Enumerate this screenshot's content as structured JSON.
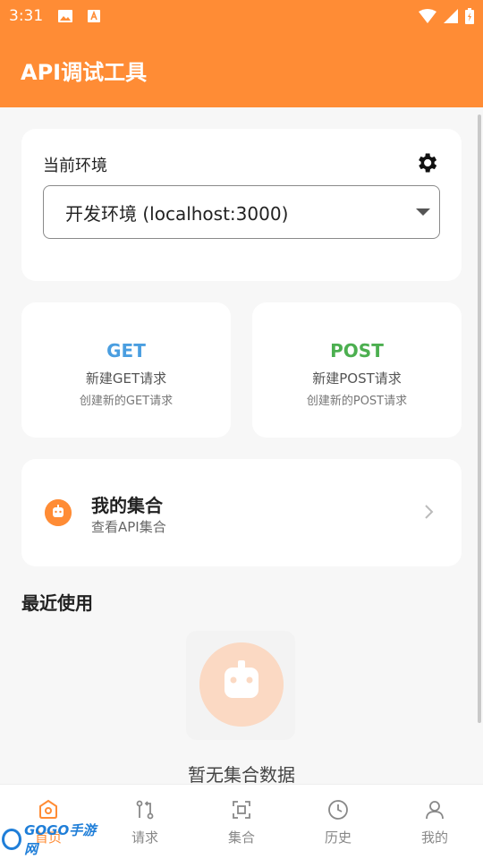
{
  "status_bar": {
    "time": "3:31",
    "icons": [
      "image-icon",
      "a-notification-icon",
      "wifi-icon",
      "signal-icon",
      "battery-icon"
    ]
  },
  "app_bar": {
    "title": "API调试工具"
  },
  "environment": {
    "label": "当前环境",
    "selected": "开发环境 (localhost:3000)",
    "settings_icon": "gear-icon"
  },
  "methods": [
    {
      "method": "GET",
      "title": "新建GET请求",
      "subtitle": "创建新的GET请求",
      "color": "#4a9ee0"
    },
    {
      "method": "POST",
      "title": "新建POST请求",
      "subtitle": "创建新的POST请求",
      "color": "#4caf50"
    }
  ],
  "collections_card": {
    "title": "我的集合",
    "subtitle": "查看API集合",
    "icon": "robot-icon"
  },
  "recent": {
    "title": "最近使用",
    "empty_text": "暂无集合数据",
    "empty_icon": "robot-icon"
  },
  "bottom_nav": {
    "items": [
      {
        "label": "首页",
        "icon": "home-icon",
        "active": true
      },
      {
        "label": "请求",
        "icon": "request-icon",
        "active": false
      },
      {
        "label": "集合",
        "icon": "collection-icon",
        "active": false
      },
      {
        "label": "历史",
        "icon": "clock-icon",
        "active": false
      },
      {
        "label": "我的",
        "icon": "user-icon",
        "active": false
      }
    ]
  },
  "watermark": {
    "text": "GOGO手游网"
  },
  "colors": {
    "primary": "#ff8c35",
    "get": "#4a9ee0",
    "post": "#4caf50"
  }
}
